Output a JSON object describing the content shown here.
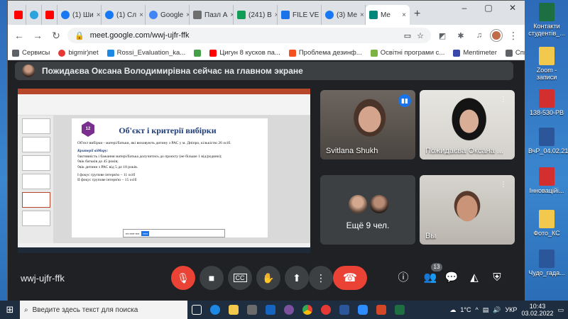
{
  "browser": {
    "tabs": [
      {
        "label": "",
        "icon": "youtube-icon",
        "color": "#ff0000"
      },
      {
        "label": "",
        "icon": "telegram-icon",
        "color": "#2aa3df"
      },
      {
        "label": "",
        "icon": "youtube-icon",
        "color": "#ff0000"
      },
      {
        "label": "(1) Ши",
        "icon": "facebook-icon",
        "color": "#1877f2"
      },
      {
        "label": "(1) Сл",
        "icon": "facebook-icon",
        "color": "#1877f2"
      },
      {
        "label": "Google",
        "icon": "google-icon",
        "color": "#4285f4"
      },
      {
        "label": "Пазл А",
        "icon": "puzzle-icon",
        "color": "#6e6e6e"
      },
      {
        "label": "(241) В",
        "icon": "sheets-icon",
        "color": "#0f9d58"
      },
      {
        "label": "FILE VE",
        "icon": "file-icon",
        "color": "#1a73e8"
      },
      {
        "label": "(3) Ме",
        "icon": "facebook-icon",
        "color": "#1877f2"
      },
      {
        "label": "Me",
        "icon": "meet-icon",
        "color": "#00897b"
      }
    ],
    "url": "meet.google.com/wwj-ujfr-ffk",
    "bookmarks": [
      {
        "label": "Сервисы",
        "icon": "apps-icon",
        "color": "#5f6368"
      },
      {
        "label": "bigmir)net",
        "icon": "bigmir-icon",
        "color": "#e53935"
      },
      {
        "label": "Rossi_Evaluation_ka...",
        "icon": "bookmark-icon",
        "color": "#1e88e5"
      },
      {
        "label": "",
        "icon": "bookmark-icon",
        "color": "#43a047"
      },
      {
        "label": "Цигун 8 кусков па...",
        "icon": "youtube-icon",
        "color": "#ff0000"
      },
      {
        "label": "Проблема дезинф...",
        "icon": "news-icon",
        "color": "#f4511e"
      },
      {
        "label": "Освітні програми с...",
        "icon": "bookmark-icon",
        "color": "#7cb342"
      },
      {
        "label": "Mentimeter",
        "icon": "menti-icon",
        "color": "#3949ab"
      }
    ],
    "reading_list": "Список для чтения"
  },
  "meet": {
    "banner": "Пожидаєва Оксана Володимирівна сейчас на главном экране",
    "slide": {
      "number": "12",
      "title": "Об'єкт і критерії вибірки",
      "lines": [
        "Об'єкт вибірки - матері/батьки, які виховують дитину з РАС у м. Дніпро, кількістю 26 осіб.",
        "Критерії відбору:",
        "◊активність і бажання матері/батька долучитись до проєкту (не більше 1 від/родини);",
        "◊вік батьків до 45 років;",
        "◊вік дитини з РАС від 5 до 18 років.",
        "I фокус групове інтерв'ю – 11 осіб",
        "II фокус групове інтерв'ю – 15 осіб"
      ]
    },
    "participants": [
      {
        "name": "Svitlana Shukh",
        "speaking": true
      },
      {
        "name": "Пожидаєва Оксана ...",
        "muted": true
      },
      {
        "name": "Ещё 9 чел."
      },
      {
        "name": "Вы",
        "muted": true
      }
    ],
    "meeting_code": "wwj-ujfr-ffk",
    "participants_count": "13"
  },
  "desktop_icons": [
    {
      "label": "Контакти студентів_...",
      "color": "#1d6f42"
    },
    {
      "label": "Zoom - записи",
      "color": "#f2c94c"
    },
    {
      "label": "138-530-РВ",
      "color": "#d32f2f"
    },
    {
      "label": "ВчР_04.02.21",
      "color": "#2b579a"
    },
    {
      "label": "Інноваційі...",
      "color": "#d32f2f"
    },
    {
      "label": "Фото_КС",
      "color": "#f2c94c"
    },
    {
      "label": "Чудо_гада...",
      "color": "#2b579a"
    }
  ],
  "taskbar": {
    "search_placeholder": "Введите здесь текст для поиска",
    "weather": "1°C",
    "lang": "УКР",
    "time": "10:43",
    "date": "03.02.2022"
  }
}
